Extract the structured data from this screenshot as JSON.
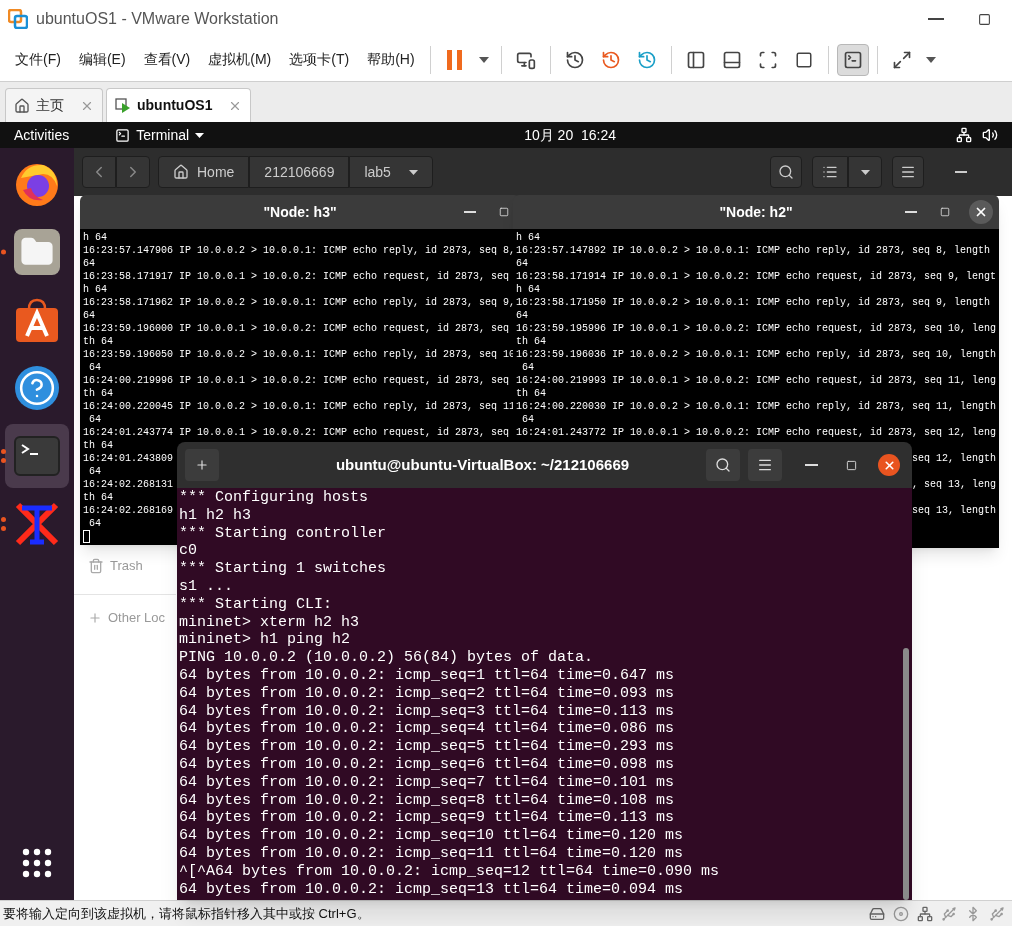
{
  "window": {
    "title": "ubuntuOS1 - VMware Workstation"
  },
  "menu": [
    "文件(F)",
    "编辑(E)",
    "查看(V)",
    "虚拟机(M)",
    "选项卡(T)",
    "帮助(H)"
  ],
  "toolbar": {
    "console_selected": true
  },
  "tabs": [
    {
      "label": "主页",
      "selected": false
    },
    {
      "label": "ubuntuOS1",
      "selected": true
    }
  ],
  "guest": {
    "top_bar": {
      "activities": "Activities",
      "app": "Terminal",
      "clock": "10月 20  16:24"
    },
    "dock": [
      {
        "kind": "firefox",
        "running": false,
        "selected": false
      },
      {
        "kind": "files",
        "running": true,
        "multiple": false,
        "selected": false
      },
      {
        "kind": "store",
        "running": false,
        "selected": false
      },
      {
        "kind": "help",
        "running": false,
        "selected": false
      },
      {
        "kind": "terminal",
        "running": true,
        "multiple": true,
        "selected": true
      },
      {
        "kind": "xterm",
        "running": true,
        "multiple": true,
        "selected": false
      }
    ],
    "file_manager": {
      "path": [
        {
          "label": "Home",
          "kind": "home"
        },
        {
          "label": "212106669",
          "kind": "folder"
        },
        {
          "label": "lab5",
          "kind": "current"
        }
      ],
      "sidebar": [
        {
          "label": "Trash",
          "kind": "trash"
        },
        {
          "label": "Other Loc",
          "kind": "add"
        }
      ]
    },
    "xterms": [
      {
        "title": "\"Node: h3\"",
        "cursor": true,
        "lines": [
          {
            "text": "h 64",
            "kind": "full"
          },
          {
            "text": "16:23:57.147906 IP 10.0.0.2 > 10.0.0.1: ICMP echo reply, id 2873, seq 8,",
            "kind": "full"
          },
          {
            "text": "64",
            "kind": "full"
          },
          {
            "text": "16:23:58.171917 IP 10.0.0.1 > 10.0.0.2: ICMP echo request, id 2873, seq",
            "kind": "full"
          },
          {
            "text": "h 64",
            "kind": "full"
          },
          {
            "text": "16:23:58.171962 IP 10.0.0.2 > 10.0.0.1: ICMP echo reply, id 2873, seq 9,",
            "kind": "full"
          },
          {
            "text": "64",
            "kind": "full"
          },
          {
            "text": "16:23:59.196000 IP 10.0.0.1 > 10.0.0.2: ICMP echo request, id 2873, seq",
            "kind": "full"
          },
          {
            "text": "th 64",
            "kind": "full"
          },
          {
            "text": "16:23:59.196050 IP 10.0.0.2 > 10.0.0.1: ICMP echo reply, id 2873, seq 10",
            "kind": "full"
          },
          {
            "text": " 64",
            "kind": "full"
          },
          {
            "text": "16:24:00.219996 IP 10.0.0.1 > 10.0.0.2: ICMP echo request, id 2873, seq",
            "kind": "full"
          },
          {
            "text": "th 64",
            "kind": "full"
          },
          {
            "text": "16:24:00.220045 IP 10.0.0.2 > 10.0.0.1: ICMP echo reply, id 2873, seq 11",
            "kind": "full"
          },
          {
            "text": " 64",
            "kind": "full"
          },
          {
            "text": "16:24:01.243774 IP 10.0.0.1 > 10.0.0.2: ICMP echo request, id 2873, seq",
            "kind": "full"
          },
          {
            "text": "th 64",
            "kind": "full"
          },
          {
            "text": "16:24:01.243809",
            "kind": "full"
          },
          {
            "text": " 64",
            "kind": "full"
          },
          {
            "text": "16:24:02.268131",
            "kind": "full"
          },
          {
            "text": "th 64",
            "kind": "full"
          },
          {
            "text": "16:24:02.268169",
            "kind": "full"
          },
          {
            "text": " 64",
            "kind": "full"
          }
        ]
      },
      {
        "title": "\"Node: h2\"",
        "close_visible": true,
        "lines": [
          {
            "text": "h 64",
            "kind": "full"
          },
          {
            "text": "16:23:57.147892 IP 10.0.0.2 > 10.0.0.1: ICMP echo reply, id 2873, seq 8, length",
            "kind": "full"
          },
          {
            "text": "64",
            "kind": "full"
          },
          {
            "text": "16:23:58.171914 IP 10.0.0.1 > 10.0.0.2: ICMP echo request, id 2873, seq 9, lengt",
            "kind": "full"
          },
          {
            "text": "h 64",
            "kind": "full"
          },
          {
            "text": "16:23:58.171950 IP 10.0.0.2 > 10.0.0.1: ICMP echo reply, id 2873, seq 9, length",
            "kind": "full"
          },
          {
            "text": "64",
            "kind": "full"
          },
          {
            "text": "16:23:59.195996 IP 10.0.0.1 > 10.0.0.2: ICMP echo request, id 2873, seq 10, leng",
            "kind": "full"
          },
          {
            "text": "th 64",
            "kind": "full"
          },
          {
            "text": "16:23:59.196036 IP 10.0.0.2 > 10.0.0.1: ICMP echo reply, id 2873, seq 10, length",
            "kind": "full"
          },
          {
            "text": " 64",
            "kind": "full"
          },
          {
            "text": "16:24:00.219993 IP 10.0.0.1 > 10.0.0.2: ICMP echo request, id 2873, seq 11, leng",
            "kind": "full"
          },
          {
            "text": "th 64",
            "kind": "full"
          },
          {
            "text": "16:24:00.220030 IP 10.0.0.2 > 10.0.0.1: ICMP echo reply, id 2873, seq 11, length",
            "kind": "full"
          },
          {
            "text": " 64",
            "kind": "full"
          },
          {
            "text": "16:24:01.243772 IP 10.0.0.1 > 10.0.0.2: ICMP echo request, id 2873, seq 12, leng",
            "kind": "full"
          },
          {
            "text": "seq 12, length",
            "kind": "tail"
          },
          {
            "text": ", seq 13, leng",
            "kind": "tail"
          },
          {
            "text": "seq 13, length",
            "kind": "tail"
          }
        ]
      }
    ],
    "terminal": {
      "title": "ubuntu@ubuntu-VirtualBox: ~/212106669",
      "lines": [
        "*** Configuring hosts",
        "h1 h2 h3",
        "*** Starting controller",
        "c0",
        "*** Starting 1 switches",
        "s1 ...",
        "*** Starting CLI:",
        "mininet> xterm h2 h3",
        "mininet> h1 ping h2",
        "PING 10.0.0.2 (10.0.0.2) 56(84) bytes of data.",
        "64 bytes from 10.0.0.2: icmp_seq=1 ttl=64 time=0.647 ms",
        "64 bytes from 10.0.0.2: icmp_seq=2 ttl=64 time=0.093 ms",
        "64 bytes from 10.0.0.2: icmp_seq=3 ttl=64 time=0.113 ms",
        "64 bytes from 10.0.0.2: icmp_seq=4 ttl=64 time=0.086 ms",
        "64 bytes from 10.0.0.2: icmp_seq=5 ttl=64 time=0.293 ms",
        "64 bytes from 10.0.0.2: icmp_seq=6 ttl=64 time=0.098 ms",
        "64 bytes from 10.0.0.2: icmp_seq=7 ttl=64 time=0.101 ms",
        "64 bytes from 10.0.0.2: icmp_seq=8 ttl=64 time=0.108 ms",
        "64 bytes from 10.0.0.2: icmp_seq=9 ttl=64 time=0.113 ms",
        "64 bytes from 10.0.0.2: icmp_seq=10 ttl=64 time=0.120 ms",
        "64 bytes from 10.0.0.2: icmp_seq=11 ttl=64 time=0.120 ms",
        "^[^A64 bytes from 10.0.0.2: icmp_seq=12 ttl=64 time=0.090 ms",
        "64 bytes from 10.0.0.2: icmp_seq=13 ttl=64 time=0.094 ms"
      ]
    }
  },
  "status_bar": {
    "message": "要将输入定向到该虚拟机，请将鼠标指针移入其中或按 Ctrl+G。"
  }
}
